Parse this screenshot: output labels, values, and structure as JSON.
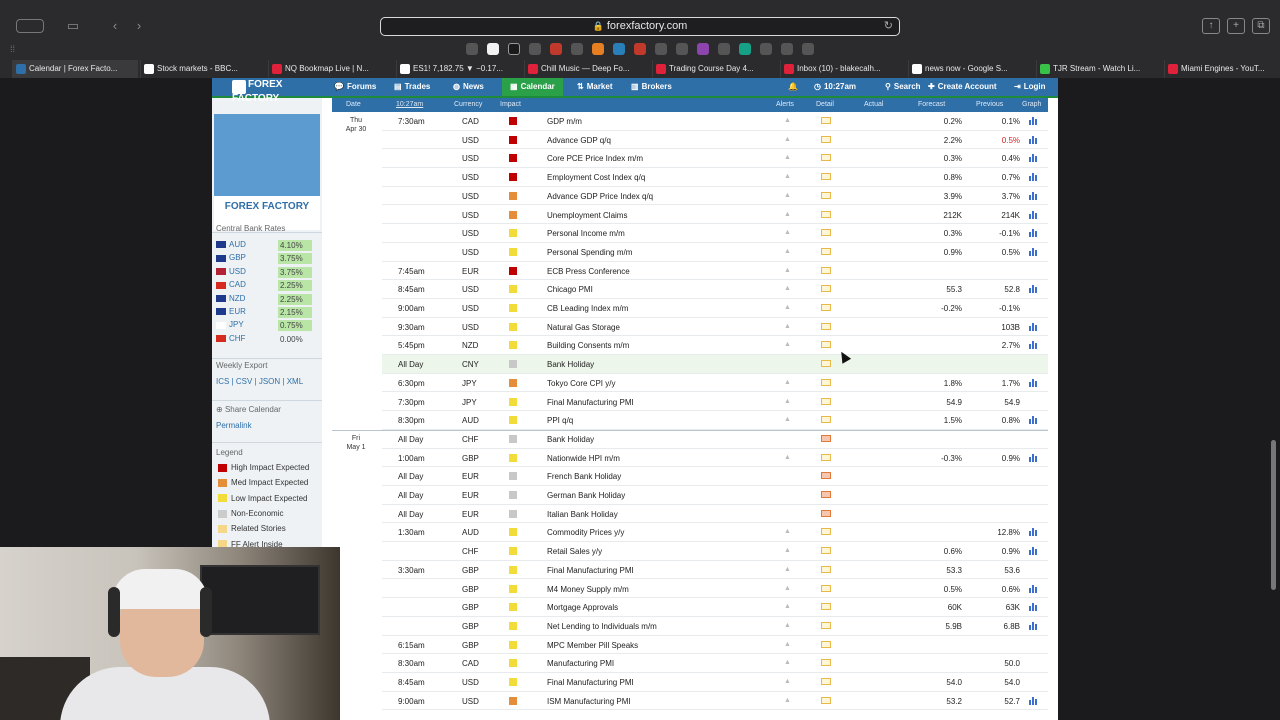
{
  "browser": {
    "url": "forexfactory.com",
    "tabs": [
      {
        "label": "Calendar | Forex Facto...",
        "color": "#2f6fa8",
        "active": true
      },
      {
        "label": "Stock markets - BBC...",
        "color": "#ffffff"
      },
      {
        "label": "NQ Bookmap Live | N...",
        "color": "#e0213a"
      },
      {
        "label": "ES1! 7,182.75 ▼ −0.17...",
        "color": "#ffffff"
      },
      {
        "label": "Chill Music — Deep Fo...",
        "color": "#e0213a"
      },
      {
        "label": "Trading Course Day 4...",
        "color": "#e0213a"
      },
      {
        "label": "Inbox (10) - blakecalh...",
        "color": "#e0213a"
      },
      {
        "label": "news now - Google S...",
        "color": "#ffffff"
      },
      {
        "label": "TJR Stream - Watch Li...",
        "color": "#39c24a"
      },
      {
        "label": "Miami Engines - YouT...",
        "color": "#e0213a"
      }
    ]
  },
  "nav": {
    "logo": "FOREX FACTORY",
    "items": [
      {
        "label": "Forums",
        "icon": "chat-icon"
      },
      {
        "label": "Trades",
        "icon": "chart-icon"
      },
      {
        "label": "News",
        "icon": "globe-icon"
      },
      {
        "label": "Calendar",
        "icon": "calendar-icon"
      },
      {
        "label": "Market",
        "icon": "market-icon"
      },
      {
        "label": "Brokers",
        "icon": "brokers-icon"
      }
    ],
    "time": "10:27am",
    "search": "Search",
    "create_account": "Create Account",
    "login": "Login"
  },
  "sidebar": {
    "banner_text": "FOREX FACTORY",
    "central_bank_title": "Central Bank Rates",
    "rates": [
      {
        "currency": "AUD",
        "rate": "4.10%",
        "flag_color": "#1f3a8a",
        "highlight": true
      },
      {
        "currency": "GBP",
        "rate": "3.75%",
        "flag_color": "#1f3a8a",
        "highlight": true
      },
      {
        "currency": "USD",
        "rate": "3.75%",
        "flag_color": "#b22234",
        "highlight": true
      },
      {
        "currency": "CAD",
        "rate": "2.25%",
        "flag_color": "#d52b1e",
        "highlight": true
      },
      {
        "currency": "NZD",
        "rate": "2.25%",
        "flag_color": "#1f3a8a",
        "highlight": true
      },
      {
        "currency": "EUR",
        "rate": "2.15%",
        "flag_color": "#1f3a8a",
        "highlight": true
      },
      {
        "currency": "JPY",
        "rate": "0.75%",
        "flag_color": "#ffffff",
        "highlight": true
      },
      {
        "currency": "CHF",
        "rate": "0.00%",
        "flag_color": "#d52b1e",
        "highlight": false
      }
    ],
    "weekly_export_title": "Weekly Export",
    "export_links": "ICS | CSV | JSON | XML",
    "share_title": "Share Calendar",
    "permalink": "Permalink",
    "legend_title": "Legend",
    "legend": [
      {
        "label": "High Impact Expected",
        "color": "#c00000"
      },
      {
        "label": "Med Impact Expected",
        "color": "#e58e3a"
      },
      {
        "label": "Low Impact Expected",
        "color": "#f2dc3a"
      },
      {
        "label": "Non-Economic",
        "color": "#cccccc"
      },
      {
        "label": "Related Stories",
        "color": "#f5d78a"
      },
      {
        "label": "FF Alert Inside",
        "color": "#f5d78a"
      }
    ]
  },
  "calendar": {
    "headers": {
      "date": "Date",
      "time": "10:27am",
      "currency": "Currency",
      "impact": "Impact",
      "alerts": "Alerts",
      "detail": "Detail",
      "actual": "Actual",
      "forecast": "Forecast",
      "previous": "Previous",
      "graph": "Graph"
    },
    "days": [
      {
        "day": "Thu",
        "date": "Apr 30",
        "row": 0
      },
      {
        "day": "Fri",
        "date": "May 1",
        "row": 17
      }
    ],
    "rows": [
      {
        "time": "7:30am",
        "currency": "CAD",
        "impact": "high",
        "event": "GDP m/m",
        "forecast": "0.2%",
        "previous": "0.1%",
        "prev_red": false,
        "graph": true,
        "alert": true
      },
      {
        "time": "",
        "currency": "USD",
        "impact": "high",
        "event": "Advance GDP q/q",
        "forecast": "2.2%",
        "previous": "0.5%",
        "prev_red": true,
        "graph": true,
        "alert": true
      },
      {
        "time": "",
        "currency": "USD",
        "impact": "high",
        "event": "Core PCE Price Index m/m",
        "forecast": "0.3%",
        "previous": "0.4%",
        "prev_red": false,
        "graph": true,
        "alert": true
      },
      {
        "time": "",
        "currency": "USD",
        "impact": "high",
        "event": "Employment Cost Index q/q",
        "forecast": "0.8%",
        "previous": "0.7%",
        "prev_red": false,
        "graph": true,
        "alert": true
      },
      {
        "time": "",
        "currency": "USD",
        "impact": "med",
        "event": "Advance GDP Price Index q/q",
        "forecast": "3.9%",
        "previous": "3.7%",
        "prev_red": false,
        "graph": true,
        "alert": true
      },
      {
        "time": "",
        "currency": "USD",
        "impact": "med",
        "event": "Unemployment Claims",
        "forecast": "212K",
        "previous": "214K",
        "prev_red": false,
        "graph": true,
        "alert": true
      },
      {
        "time": "",
        "currency": "USD",
        "impact": "low",
        "event": "Personal Income m/m",
        "forecast": "0.3%",
        "previous": "-0.1%",
        "prev_red": false,
        "graph": true,
        "alert": true
      },
      {
        "time": "",
        "currency": "USD",
        "impact": "low",
        "event": "Personal Spending m/m",
        "forecast": "0.9%",
        "previous": "0.5%",
        "prev_red": false,
        "graph": true,
        "alert": true
      },
      {
        "time": "7:45am",
        "currency": "EUR",
        "impact": "high",
        "event": "ECB Press Conference",
        "forecast": "",
        "previous": "",
        "prev_red": false,
        "graph": false,
        "alert": true
      },
      {
        "time": "8:45am",
        "currency": "USD",
        "impact": "low",
        "event": "Chicago PMI",
        "forecast": "55.3",
        "previous": "52.8",
        "prev_red": false,
        "graph": true,
        "alert": true
      },
      {
        "time": "9:00am",
        "currency": "USD",
        "impact": "low",
        "event": "CB Leading Index m/m",
        "forecast": "-0.2%",
        "previous": "-0.1%",
        "prev_red": false,
        "graph": false,
        "alert": true
      },
      {
        "time": "9:30am",
        "currency": "USD",
        "impact": "low",
        "event": "Natural Gas Storage",
        "forecast": "",
        "previous": "103B",
        "prev_red": false,
        "graph": true,
        "alert": true
      },
      {
        "time": "5:45pm",
        "currency": "NZD",
        "impact": "low",
        "event": "Building Consents m/m",
        "forecast": "",
        "previous": "2.7%",
        "prev_red": false,
        "graph": true,
        "alert": true
      },
      {
        "time": "All Day",
        "currency": "CNY",
        "impact": "non",
        "event": "Bank Holiday",
        "forecast": "",
        "previous": "",
        "prev_red": false,
        "graph": false,
        "alert": false,
        "highlight": true
      },
      {
        "time": "6:30pm",
        "currency": "JPY",
        "impact": "med",
        "event": "Tokyo Core CPI y/y",
        "forecast": "1.8%",
        "previous": "1.7%",
        "prev_red": false,
        "graph": true,
        "alert": true
      },
      {
        "time": "7:30pm",
        "currency": "JPY",
        "impact": "low",
        "event": "Final Manufacturing PMI",
        "forecast": "54.9",
        "previous": "54.9",
        "prev_red": false,
        "graph": false,
        "alert": true
      },
      {
        "time": "8:30pm",
        "currency": "AUD",
        "impact": "low",
        "event": "PPI q/q",
        "forecast": "1.5%",
        "previous": "0.8%",
        "prev_red": false,
        "graph": true,
        "alert": true
      },
      {
        "time": "All Day",
        "currency": "CHF",
        "impact": "non",
        "event": "Bank Holiday",
        "forecast": "",
        "previous": "",
        "prev_red": false,
        "graph": false,
        "alert": false,
        "folder_red": true
      },
      {
        "time": "1:00am",
        "currency": "GBP",
        "impact": "low",
        "event": "Nationwide HPI m/m",
        "forecast": "-0.3%",
        "previous": "0.9%",
        "prev_red": false,
        "graph": true,
        "alert": true
      },
      {
        "time": "All Day",
        "currency": "EUR",
        "impact": "non",
        "event": "French Bank Holiday",
        "forecast": "",
        "previous": "",
        "prev_red": false,
        "graph": false,
        "alert": false,
        "folder_red": true
      },
      {
        "time": "All Day",
        "currency": "EUR",
        "impact": "non",
        "event": "German Bank Holiday",
        "forecast": "",
        "previous": "",
        "prev_red": false,
        "graph": false,
        "alert": false,
        "folder_red": true
      },
      {
        "time": "All Day",
        "currency": "EUR",
        "impact": "non",
        "event": "Italian Bank Holiday",
        "forecast": "",
        "previous": "",
        "prev_red": false,
        "graph": false,
        "alert": false,
        "folder_red": true
      },
      {
        "time": "1:30am",
        "currency": "AUD",
        "impact": "low",
        "event": "Commodity Prices y/y",
        "forecast": "",
        "previous": "12.8%",
        "prev_red": false,
        "graph": true,
        "alert": true
      },
      {
        "time": "",
        "currency": "CHF",
        "impact": "low",
        "event": "Retail Sales y/y",
        "forecast": "0.6%",
        "previous": "0.9%",
        "prev_red": false,
        "graph": true,
        "alert": true
      },
      {
        "time": "3:30am",
        "currency": "GBP",
        "impact": "low",
        "event": "Final Manufacturing PMI",
        "forecast": "53.3",
        "previous": "53.6",
        "prev_red": false,
        "graph": false,
        "alert": true
      },
      {
        "time": "",
        "currency": "GBP",
        "impact": "low",
        "event": "M4 Money Supply m/m",
        "forecast": "0.5%",
        "previous": "0.6%",
        "prev_red": false,
        "graph": true,
        "alert": true
      },
      {
        "time": "",
        "currency": "GBP",
        "impact": "low",
        "event": "Mortgage Approvals",
        "forecast": "60K",
        "previous": "63K",
        "prev_red": false,
        "graph": true,
        "alert": true
      },
      {
        "time": "",
        "currency": "GBP",
        "impact": "low",
        "event": "Net Lending to Individuals m/m",
        "forecast": "5.9B",
        "previous": "6.8B",
        "prev_red": false,
        "graph": true,
        "alert": true
      },
      {
        "time": "6:15am",
        "currency": "GBP",
        "impact": "low",
        "event": "MPC Member Pill Speaks",
        "forecast": "",
        "previous": "",
        "prev_red": false,
        "graph": false,
        "alert": true
      },
      {
        "time": "8:30am",
        "currency": "CAD",
        "impact": "low",
        "event": "Manufacturing PMI",
        "forecast": "",
        "previous": "50.0",
        "prev_red": false,
        "graph": false,
        "alert": true
      },
      {
        "time": "8:45am",
        "currency": "USD",
        "impact": "low",
        "event": "Final Manufacturing PMI",
        "forecast": "54.0",
        "previous": "54.0",
        "prev_red": false,
        "graph": false,
        "alert": true
      },
      {
        "time": "9:00am",
        "currency": "USD",
        "impact": "med",
        "event": "ISM Manufacturing PMI",
        "forecast": "53.2",
        "previous": "52.7",
        "prev_red": false,
        "graph": true,
        "alert": true
      }
    ]
  },
  "colors": {
    "high": "#c00000",
    "med": "#e58e3a",
    "low": "#f2dc3a",
    "non": "#c8c8c8"
  }
}
